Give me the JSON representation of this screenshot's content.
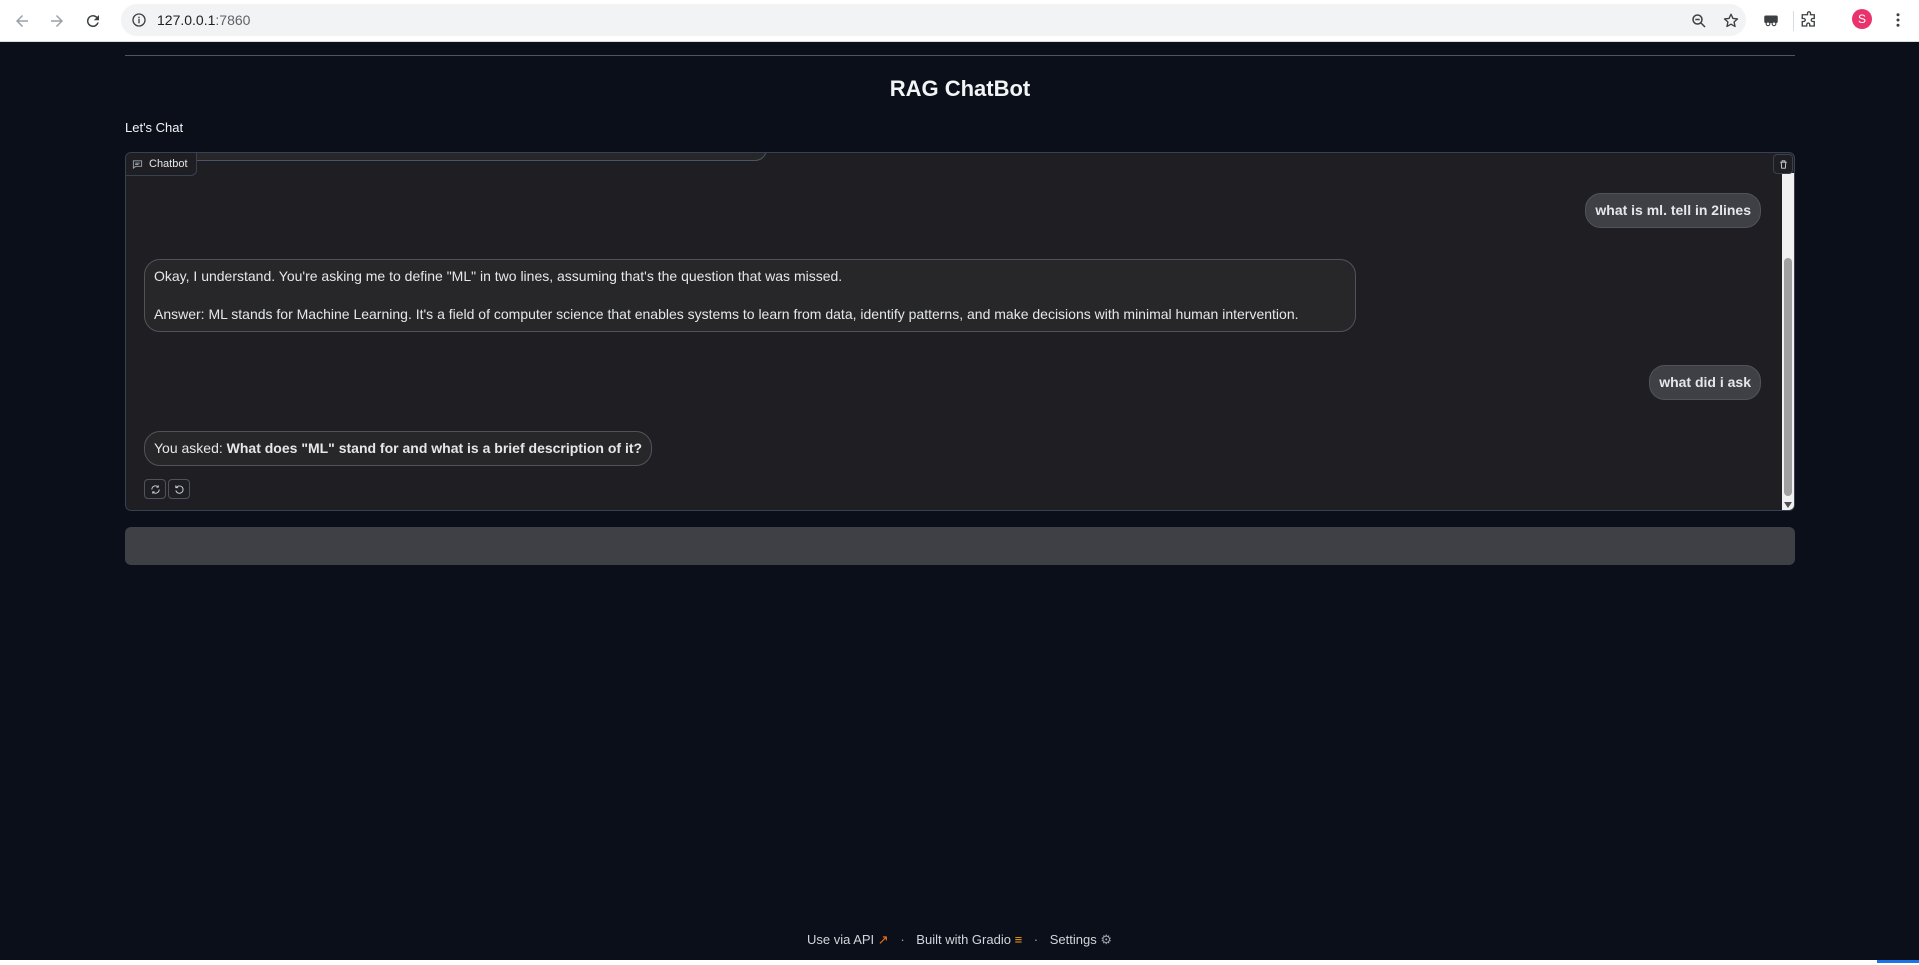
{
  "browser": {
    "url_host": "127.0.0.1",
    "url_port": ":7860",
    "profile_initial": "S"
  },
  "app": {
    "title": "RAG ChatBot",
    "subtitle": "Let's Chat",
    "chatbot_label": "Chatbot"
  },
  "messages": [
    {
      "role": "user",
      "text": "what is ml. tell in 2lines"
    },
    {
      "role": "bot",
      "lines": [
        "Okay, I understand. You're asking me to define \"ML\" in two lines, assuming that's the question that was missed.",
        "Answer: ML stands for Machine Learning. It's a field of computer science that enables systems to learn from data, identify patterns, and make decisions with minimal human intervention."
      ]
    },
    {
      "role": "user",
      "text": "what did i ask"
    },
    {
      "role": "bot",
      "prefix": "You asked: ",
      "bold": "What does \"ML\" stand for and what is a brief description of it?"
    }
  ],
  "input": {
    "placeholder": ""
  },
  "footer": {
    "api": "Use via API",
    "built": "Built with Gradio",
    "settings": "Settings"
  },
  "colors": {
    "background": "#0b0f19",
    "panel": "#1f1f23",
    "user_bubble": "#3f3f46",
    "accent_orange": "#f97316"
  }
}
